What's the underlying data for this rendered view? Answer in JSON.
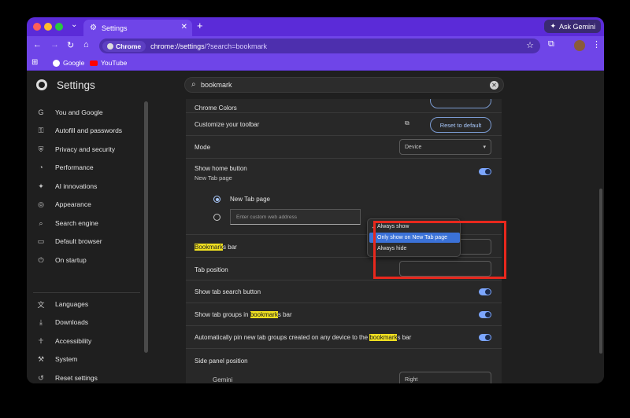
{
  "tabs": [
    {
      "label": "Settings",
      "icon": "gear-icon"
    }
  ],
  "gemini_button": "Ask Gemini",
  "omnibox": {
    "chip": "Chrome",
    "url_host": "chrome://settings",
    "url_rest": "/?search=bookmark"
  },
  "bookmarks_bar": [
    {
      "label": "Google"
    },
    {
      "label": "YouTube"
    }
  ],
  "settings": {
    "title": "Settings",
    "search_value": "bookmark",
    "sidebar": [
      {
        "label": "You and Google",
        "icon": "google-icon"
      },
      {
        "label": "Autofill and passwords",
        "icon": "key-icon"
      },
      {
        "label": "Privacy and security",
        "icon": "shield-icon"
      },
      {
        "label": "Performance",
        "icon": "speedometer-icon"
      },
      {
        "label": "AI innovations",
        "icon": "sparkle-icon"
      },
      {
        "label": "Appearance",
        "icon": "palette-icon"
      },
      {
        "label": "Search engine",
        "icon": "search-icon"
      },
      {
        "label": "Default browser",
        "icon": "browser-icon"
      },
      {
        "label": "On startup",
        "icon": "power-icon"
      },
      {
        "label": "Languages",
        "icon": "translate-icon"
      },
      {
        "label": "Downloads",
        "icon": "download-icon"
      },
      {
        "label": "Accessibility",
        "icon": "accessibility-icon"
      },
      {
        "label": "System",
        "icon": "wrench-icon"
      },
      {
        "label": "Reset settings",
        "icon": "reset-icon"
      }
    ],
    "rows": {
      "chrome_colors": "Chrome Colors",
      "customize_toolbar": "Customize your toolbar",
      "reset_default": "Reset to default",
      "mode": "Mode",
      "mode_value": "Device",
      "show_home": "Show home button",
      "show_home_sub": "New Tab page",
      "new_tab_page": "New Tab page",
      "custom_address_placeholder": "Enter custom web address",
      "bookmarks_bar_hl": "Bookmark",
      "bookmarks_bar_rest": "s bar",
      "tab_position": "Tab position",
      "tab_search": "Show tab search button",
      "tab_groups_pre": "Show tab groups in ",
      "tab_groups_hl": "bookmark",
      "tab_groups_post": "s bar",
      "auto_pin_pre": "Automatically pin new tab groups created on any device to the ",
      "auto_pin_hl": "bookmark",
      "auto_pin_post": "s bar",
      "side_panel": "Side panel position",
      "gemini_label": "Gemini",
      "gemini_value": "Right"
    },
    "dropdown": {
      "options": [
        "Always show",
        "Only show on New Tab page",
        "Always hide"
      ],
      "checked_index": 0,
      "highlighted_index": 1
    }
  },
  "colors": {
    "accent": "#6f45e8",
    "highlight": "#f0e020",
    "toggle": "#7ca6ff",
    "annotation": "#e8281d"
  }
}
